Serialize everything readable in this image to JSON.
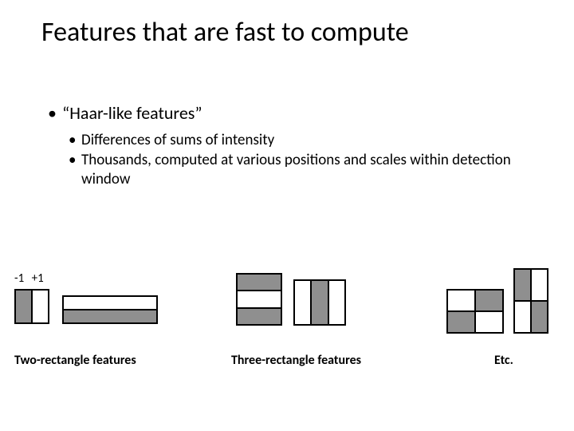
{
  "title": "Features that are fast to compute",
  "bullets": {
    "lvl1": "“Haar-like features”",
    "lvl2a": "Differences of sums of intensity",
    "lvl2b": "Thousands, computed at various positions and scales within detection window"
  },
  "legend": {
    "minus": "-1",
    "plus": "+1"
  },
  "captions": {
    "two": "Two-rectangle features",
    "three": "Three-rectangle features",
    "etc": "Etc."
  },
  "features": {
    "twoA": {
      "type": "vertical-split-2",
      "fill": [
        "gray",
        "white"
      ]
    },
    "twoB": {
      "type": "horizontal-split-2",
      "fill": [
        "white",
        "gray"
      ]
    },
    "threeA": {
      "type": "horizontal-split-3",
      "fill": [
        "gray",
        "white",
        "gray"
      ]
    },
    "threeB": {
      "type": "vertical-split-3",
      "fill": [
        "white",
        "gray",
        "white"
      ]
    },
    "fourA": {
      "type": "checker-2x2",
      "fill": [
        "white",
        "gray",
        "gray",
        "white"
      ]
    },
    "fourB": {
      "type": "checker-2x2-tall",
      "fill": [
        "gray",
        "white",
        "white",
        "gray"
      ]
    }
  },
  "colors": {
    "gray": "#8f8f8f",
    "white": "#ffffff"
  }
}
